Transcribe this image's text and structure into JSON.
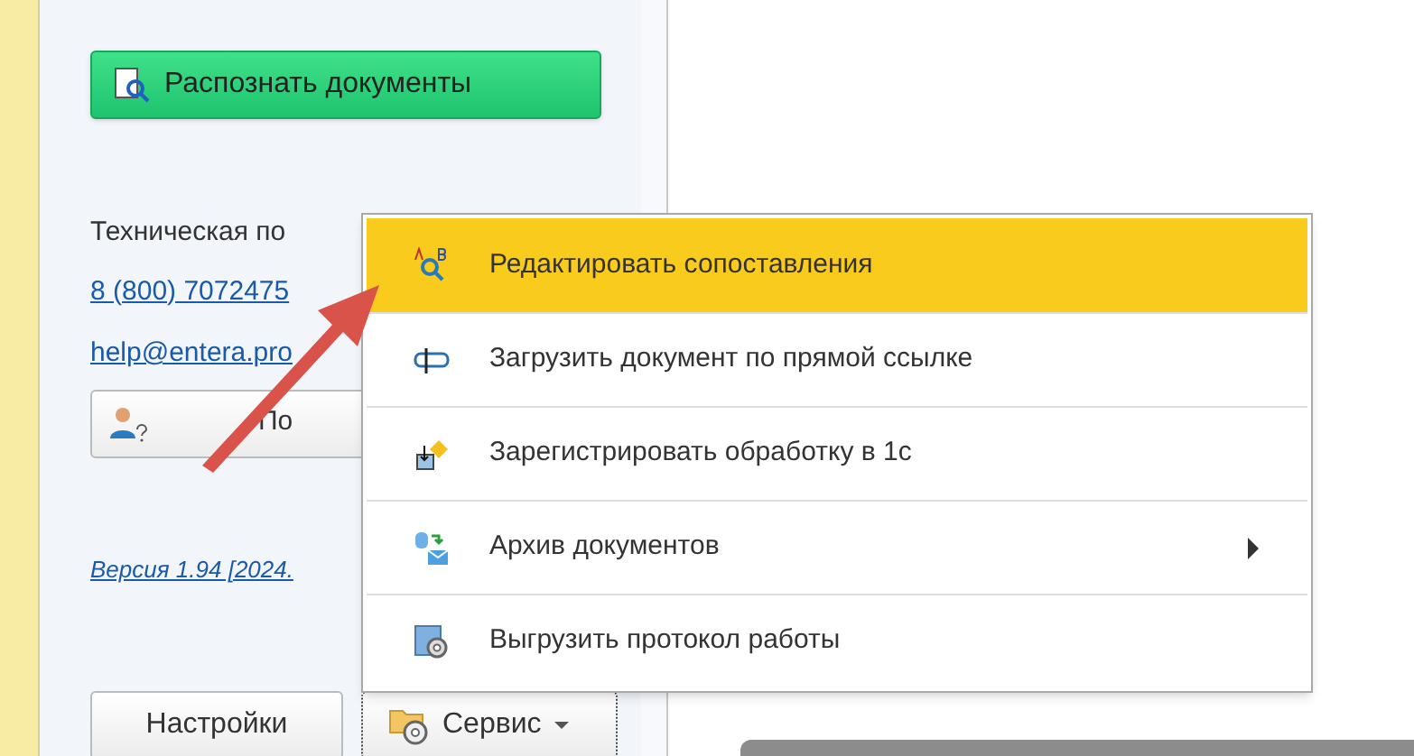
{
  "sidebar": {
    "recognize_button": "Распознать документы",
    "support_label": "Техническая по",
    "phone_link": "8 (800) 7072475",
    "email_link": "help@entera.pro",
    "help_button": "По",
    "version_link": "Версия 1.94 [2024."
  },
  "footer_buttons": [
    {
      "label": "Настройки",
      "focused": false,
      "dropdown": false
    },
    {
      "label": "Сервис",
      "focused": true,
      "dropdown": true
    }
  ],
  "menu": {
    "items": [
      {
        "label": "Редактировать сопоставления",
        "selected": true,
        "submenu": false
      },
      {
        "label": "Загрузить документ по прямой ссылке",
        "selected": false,
        "submenu": false
      },
      {
        "label": "Зарегистрировать обработку в 1с",
        "selected": false,
        "submenu": false
      },
      {
        "label": "Архив документов",
        "selected": false,
        "submenu": true
      },
      {
        "label": "Выгрузить протокол работы",
        "selected": false,
        "submenu": false
      }
    ]
  }
}
